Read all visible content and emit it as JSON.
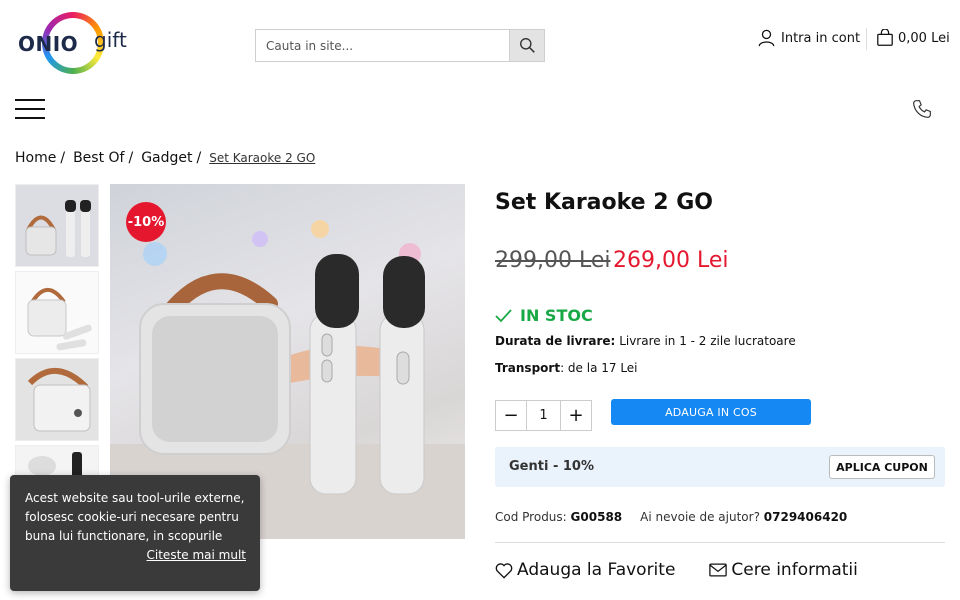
{
  "header": {
    "logo_left": "ONIO",
    "logo_right": "gift",
    "search_placeholder": "Cauta in site...",
    "account_label": "Intra in cont",
    "cart_total": "0,00 Lei"
  },
  "breadcrumb": [
    {
      "label": "Home"
    },
    {
      "label": "Best Of"
    },
    {
      "label": "Gadget"
    },
    {
      "label": "Set Karaoke 2 GO"
    }
  ],
  "breadcrumb_sep": "/",
  "product": {
    "title": "Set Karaoke 2 GO",
    "discount_badge": "-10%",
    "old_price": "299,00 Lei",
    "new_price": "269,00 Lei",
    "stock": "IN STOC",
    "delivery_label": "Durata de livrare:",
    "delivery_value": "Livrare in 1 - 2 zile lucratoare",
    "transport_label": "Transport",
    "transport_value": ": de la 17 Lei",
    "quantity": "1",
    "add_to_cart": "ADAUGA IN COS",
    "coupon_text": "Genti - 10%",
    "coupon_button": "APLICA CUPON",
    "code_label": "Cod Produs:",
    "code_value": "G00588",
    "help_label": "Ai nevoie de ajutor?",
    "help_phone": "0729406420",
    "favorite": "Adauga la Favorite",
    "info_request": "Cere informatii"
  },
  "cookie": {
    "text": "Acest website sau tool-urile externe, folosesc cookie-uri necesare pentru buna lui functionare, in scopurile",
    "more": "Citeste mai mult"
  },
  "colors": {
    "accent_red": "#e5172f",
    "stock_green": "#18a845",
    "button_blue": "#1588f3",
    "coupon_bg": "#eaf2fb"
  },
  "icons": [
    "search-icon",
    "user-icon",
    "bag-icon",
    "menu-icon",
    "phone-icon",
    "check-icon",
    "heart-icon",
    "envelope-icon"
  ]
}
